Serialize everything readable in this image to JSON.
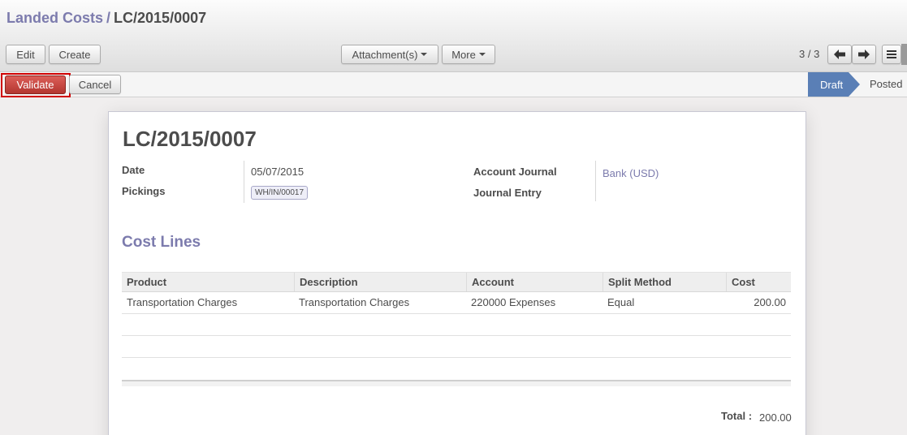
{
  "breadcrumb": {
    "parent": "Landed Costs",
    "separator": "/",
    "current": "LC/2015/0007"
  },
  "toolbar": {
    "edit_label": "Edit",
    "create_label": "Create",
    "attachments_label": "Attachment(s)",
    "more_label": "More"
  },
  "pager": {
    "text": "3 / 3"
  },
  "status": {
    "validate_label": "Validate",
    "cancel_label": "Cancel",
    "stages": [
      "Draft",
      "Posted"
    ],
    "active_stage": "Draft"
  },
  "form": {
    "title": "LC/2015/0007",
    "date_label": "Date",
    "date_value": "05/07/2015",
    "pickings_label": "Pickings",
    "pickings_value": "WH/IN/00017",
    "journal_label": "Account Journal",
    "journal_value": "Bank (USD)",
    "entry_label": "Journal Entry",
    "entry_value": ""
  },
  "cost_lines": {
    "title": "Cost Lines",
    "columns": [
      "Product",
      "Description",
      "Account",
      "Split Method",
      "Cost"
    ],
    "rows": [
      [
        "Transportation Charges",
        "Transportation Charges",
        "220000 Expenses",
        "Equal",
        "200.00"
      ]
    ],
    "total_label": "Total :",
    "total_value": "200.00"
  },
  "colors": {
    "accent": "#7c7bad",
    "validate": "#c9423b",
    "stage_active": "#5a7fb6"
  }
}
